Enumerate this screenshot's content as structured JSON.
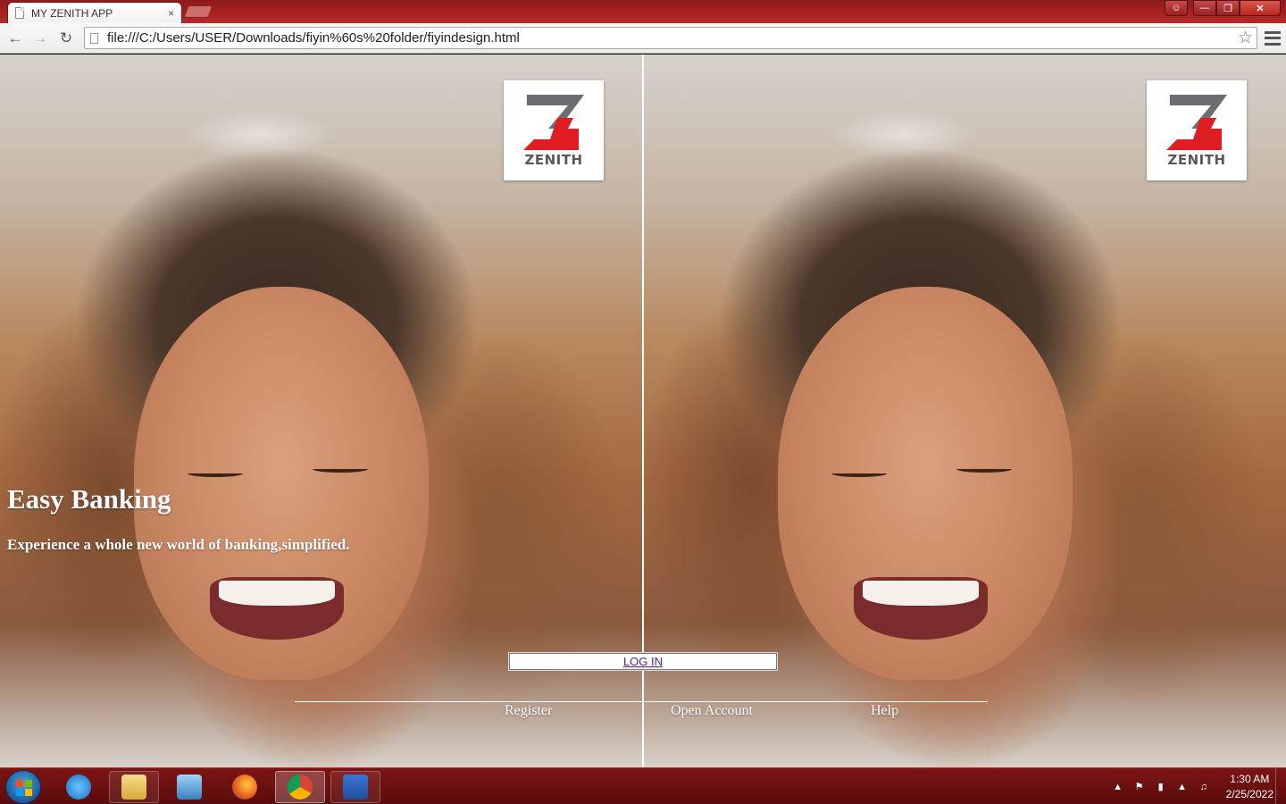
{
  "browser": {
    "tab_title": "MY ZENITH APP",
    "tab_close": "×",
    "url": "file:///C:/Users/USER/Downloads/fiyin%60s%20folder/fiyindesign.html"
  },
  "page": {
    "logo_text": "ZENITH",
    "headline": "Easy Banking",
    "subline": "Experience a whole new world of banking,simplified.",
    "login_label": "LOG IN",
    "footer_links": [
      "Register",
      "Open Account",
      "Help"
    ]
  },
  "colors": {
    "logo_red": "#e11d24",
    "logo_gray": "#6d6e71",
    "chrome_red": "#a82222",
    "link_visited": "#551a8b"
  },
  "taskbar": {
    "items": [
      "start-orb-icon",
      "internet-explorer-icon",
      "file-explorer-icon",
      "media-player-icon",
      "firefox-icon",
      "chrome-icon",
      "word-icon"
    ],
    "clock_time": "1:30 AM",
    "clock_date": "2/25/2022"
  }
}
